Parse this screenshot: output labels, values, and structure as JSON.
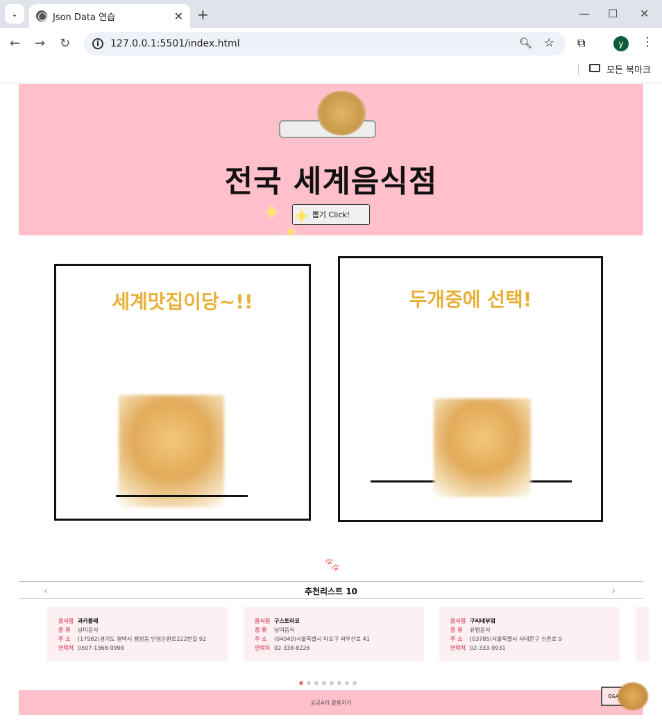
{
  "browser": {
    "tab_title": "Json Data 연습",
    "url": "127.0.0.1:5501/index.html",
    "profile_initial": "y",
    "bookmarks_label": "모든 북마크"
  },
  "hero": {
    "title": "전국 세계음식점",
    "button_label": "뽑기 Click!",
    "background": "#ffc0cb"
  },
  "cards": [
    {
      "heading": "세계맛집이당~!!"
    },
    {
      "heading": "두개중에 선택!"
    }
  ],
  "recommend": {
    "title": "추천리스트 10",
    "prev_icon": "chevron-left-icon",
    "next_icon": "chevron-right-icon",
    "labels": {
      "name": "음식점",
      "type": "종 류",
      "address": "주 소",
      "phone": "연락처"
    },
    "items": [
      {
        "name": "과카몰레",
        "type": "남미음식",
        "address": "(17982)경기도 평택시 팽성읍 안정순환로222번길 92",
        "phone": "0507-1368-9998"
      },
      {
        "name": "구스토라코",
        "type": "남미음식",
        "address": "(04049)서울특별시 마포구 와우산로 41",
        "phone": "02-338-8226"
      },
      {
        "name": "구씨네부엌",
        "type": "유럽음식",
        "address": "(03785)서울특별시 서대문구 신촌로 9",
        "phone": "02-333-9931"
      }
    ],
    "page_count": 8,
    "active_page": 1
  },
  "footer": {
    "text": "공공API 활용하기"
  },
  "qa_label": "Q&A",
  "colors": {
    "accent": "#e7b138",
    "pink": "#ffc0cb",
    "label_pink": "#e0607a"
  }
}
